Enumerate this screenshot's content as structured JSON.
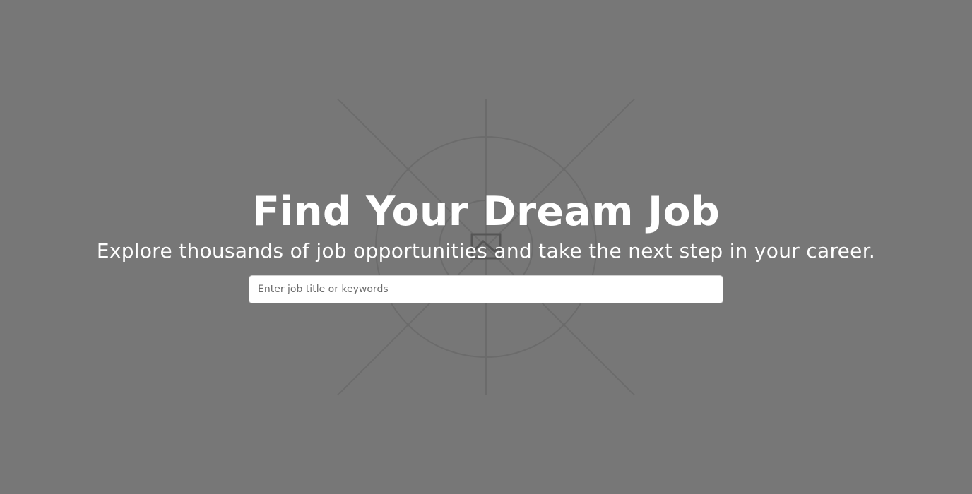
{
  "hero": {
    "title": "Find Your Dream Job",
    "subtitle": "Explore thousands of job opportunities and take the next step in your career.",
    "background_color": "#777777",
    "background_icon": "image-placeholder-icon"
  },
  "search": {
    "value": "",
    "placeholder": "Enter job title or keywords"
  }
}
